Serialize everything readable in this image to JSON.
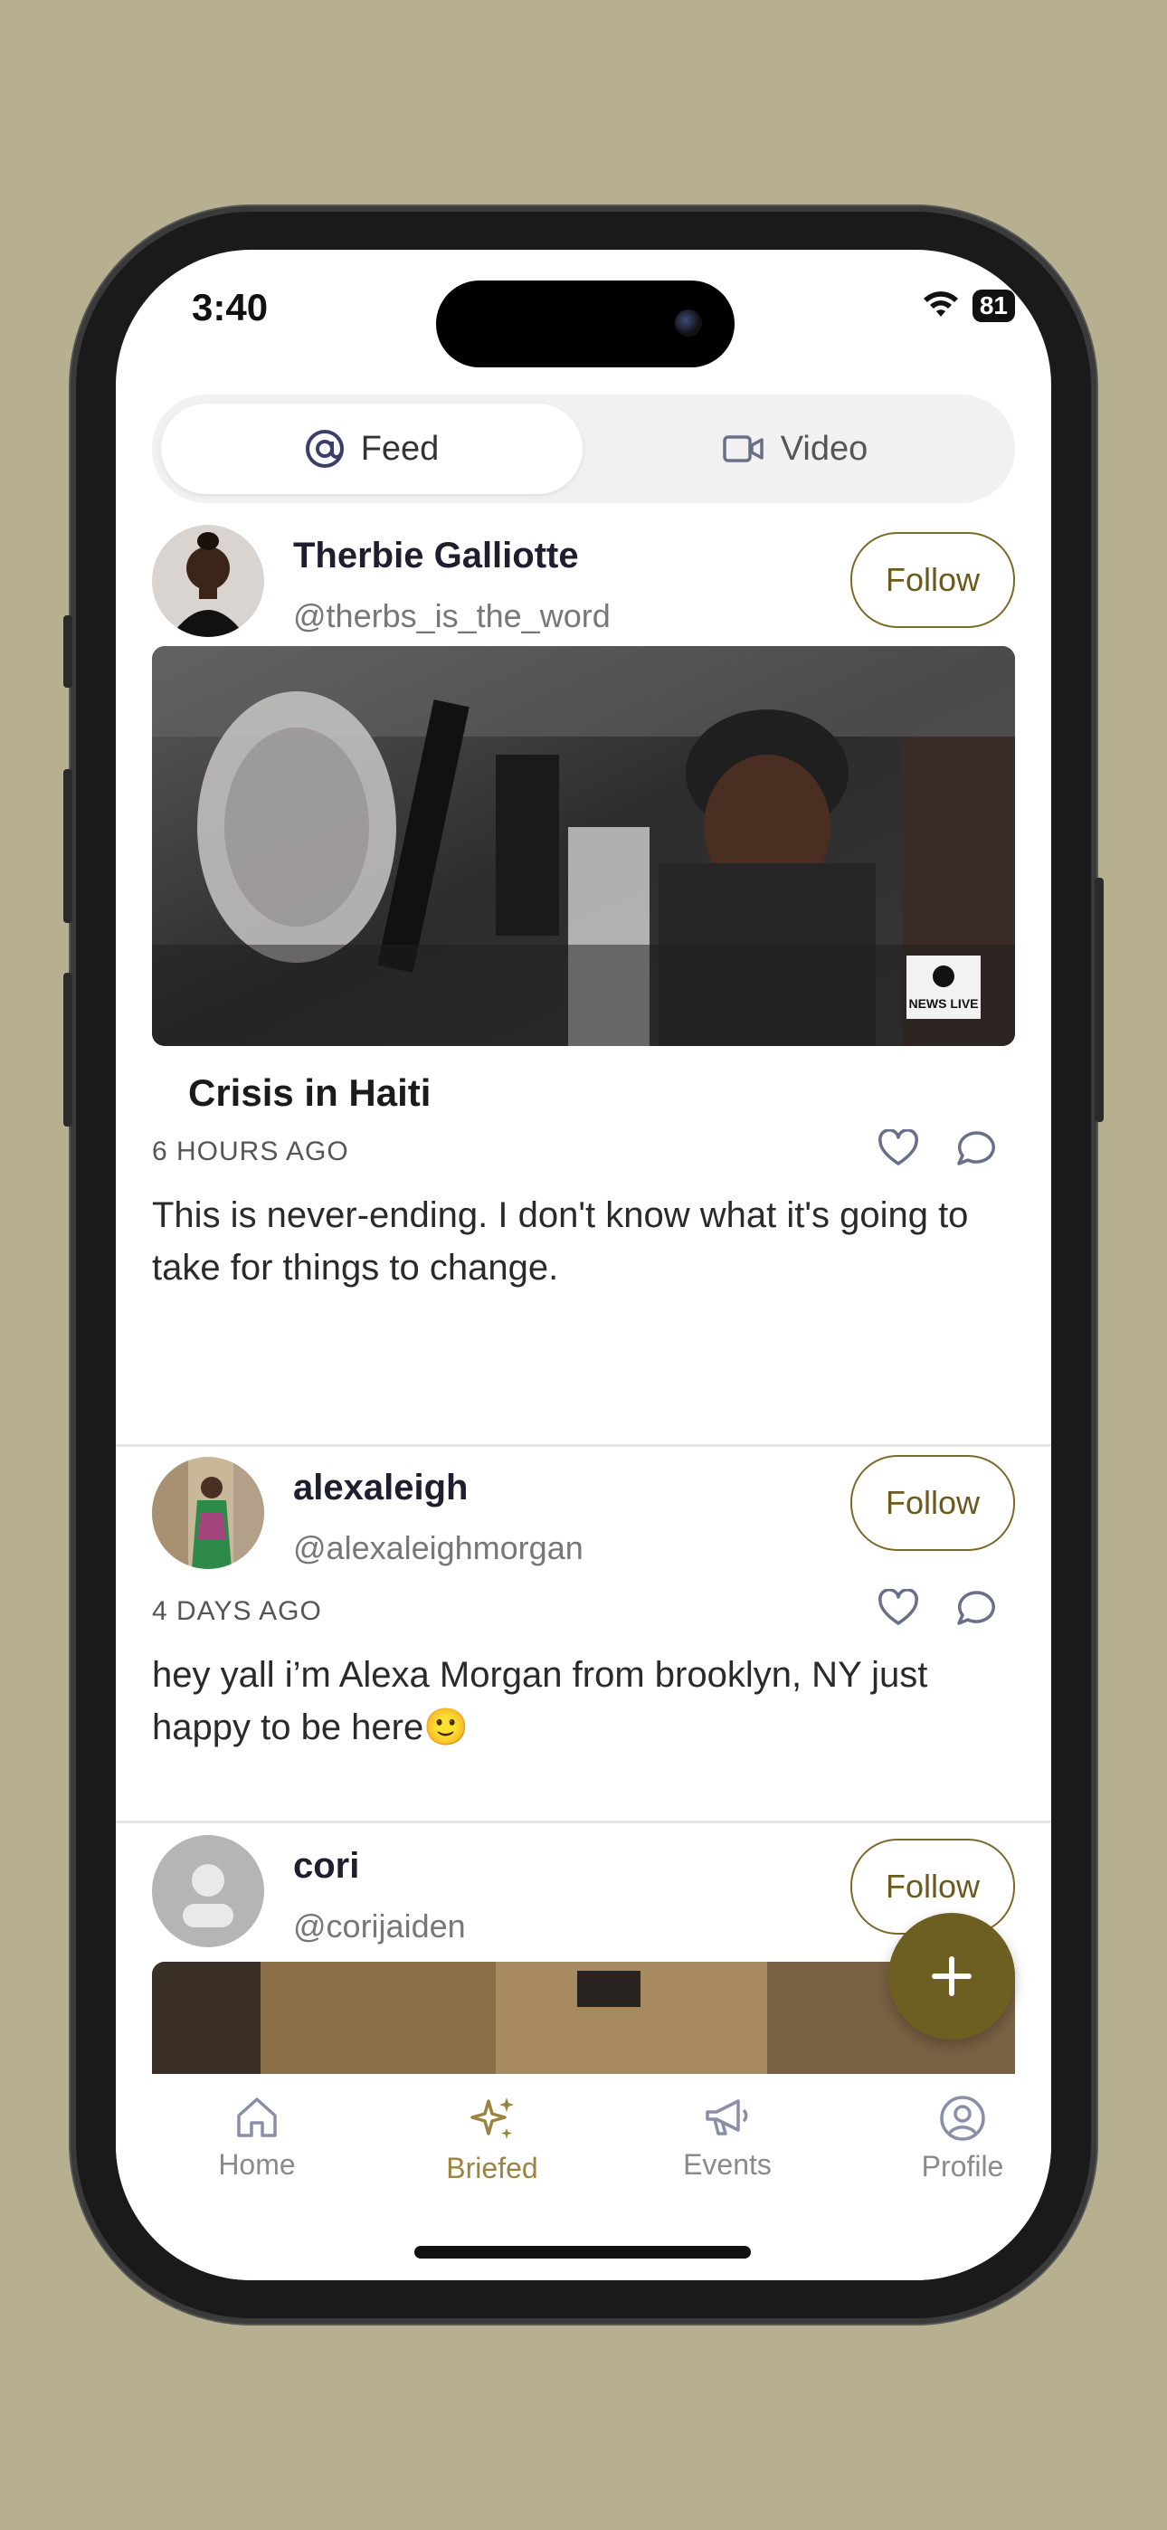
{
  "status": {
    "time": "3:40",
    "battery": "81"
  },
  "segment": {
    "feed_label": "Feed",
    "video_label": "Video"
  },
  "posts": [
    {
      "name": "Therbie Galliotte",
      "handle": "@therbs_is_the_word",
      "follow_label": "Follow",
      "media_watermark": "NEWS LIVE",
      "title": "Crisis in Haiti",
      "time": "6 HOURS AGO",
      "text": "This is never-ending. I don't know what it's going to take for things to change."
    },
    {
      "name": "alexaleigh",
      "handle": "@alexaleighmorgan",
      "follow_label": "Follow",
      "time": "4 DAYS AGO",
      "text": "hey yall i’m Alexa Morgan from brooklyn, NY just happy to be here🙂"
    },
    {
      "name": "cori",
      "handle": "@corijaiden",
      "follow_label": "Follow"
    }
  ],
  "tabbar": {
    "items": [
      {
        "label": "Home",
        "icon": "home-icon"
      },
      {
        "label": "Briefed",
        "icon": "sparkles-icon",
        "active": true
      },
      {
        "label": "Events",
        "icon": "megaphone-icon"
      },
      {
        "label": "Profile",
        "icon": "profile-icon"
      }
    ]
  },
  "colors": {
    "accent": "#6d5f22",
    "background": "#b6b090"
  }
}
